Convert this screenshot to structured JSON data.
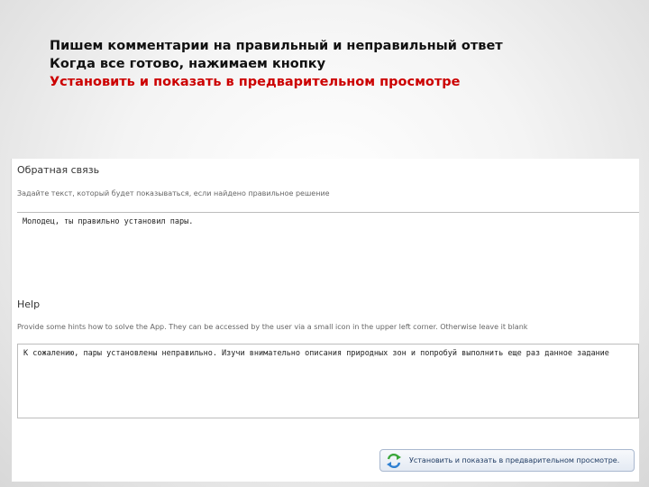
{
  "slide": {
    "line1": "Пишем комментарии на правильный и неправильный ответ",
    "line2": "Когда все готово, нажимаем кнопку",
    "line3": "Установить и показать в предварительном просмотре"
  },
  "feedback": {
    "title": "Обратная связь",
    "hint": "Задайте текст, который будет показываться, если найдено правильное решение",
    "value": "Молодец, ты правильно установил пары."
  },
  "help": {
    "title": "Help",
    "hint": "Provide some hints how to solve the App. They can be accessed by the user via a small icon in the upper left corner. Otherwise leave it blank",
    "value": "К сожалению, пары установлены неправильно. Изучи внимательно описания природных зон и попробуй выполнить еще раз данное задание"
  },
  "preview_button": {
    "label": "Установить и показать в предварительном просмотре.",
    "icon": "refresh-arrows-icon",
    "icon_color": "#3aa63a"
  },
  "colors": {
    "highlight": "#cc0000",
    "button_text": "#1f3b63"
  }
}
